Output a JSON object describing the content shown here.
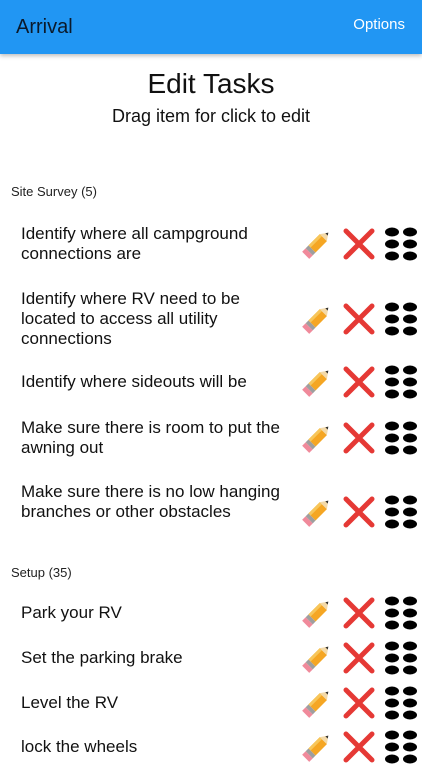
{
  "appbar": {
    "title": "Arrival",
    "options_label": "Options"
  },
  "page": {
    "title": "Edit Tasks",
    "subtitle": "Drag item for click to edit"
  },
  "icons": {
    "edit": "pencil-icon",
    "delete": "cross-icon",
    "reorder": "drag-handle-icon"
  },
  "colors": {
    "appbar": "#2196F3",
    "delete": "#E53935",
    "pencil_body": "#F5A623"
  },
  "sections": [
    {
      "title": "Site Survey (5)",
      "tasks": [
        "Identify where all campground connections are",
        "Identify where RV need to be located to access all utility connections",
        "Identify where sideouts will be",
        "Make sure there is room to put the awning out",
        "Make sure there is no low hanging branches or other obstacles"
      ]
    },
    {
      "title": "Setup (35)",
      "tasks": [
        "Park your RV",
        "Set the parking brake",
        "Level the RV",
        "lock the wheels"
      ]
    }
  ]
}
